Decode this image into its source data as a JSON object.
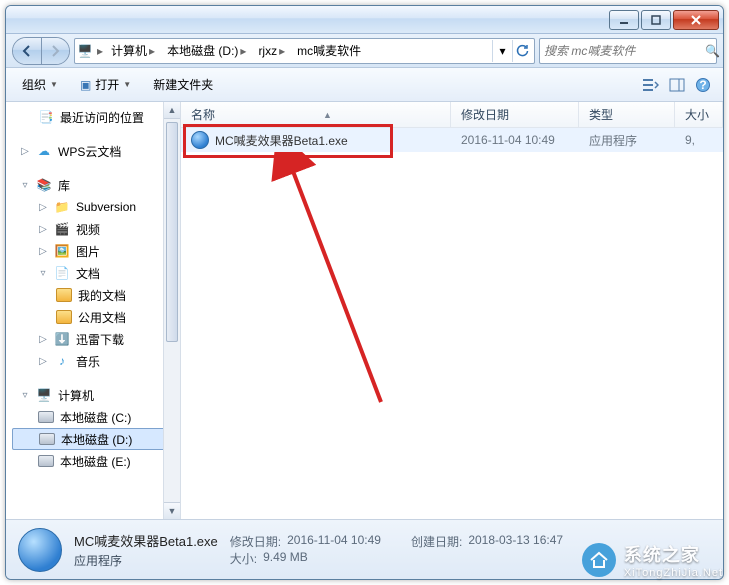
{
  "breadcrumbs": [
    "计算机",
    "本地磁盘 (D:)",
    "rjxz",
    "mc喊麦软件"
  ],
  "search": {
    "placeholder": "搜索 mc喊麦软件"
  },
  "toolbar": {
    "organize": "组织",
    "open": "打开",
    "newfolder": "新建文件夹"
  },
  "columns": {
    "name": "名称",
    "date": "修改日期",
    "type": "类型",
    "size": "大小"
  },
  "rows": [
    {
      "name": "MC喊麦效果器Beta1.exe",
      "date": "2016-11-04 10:49",
      "type": "应用程序",
      "size": "9,"
    }
  ],
  "sidebar": {
    "recent": "最近访问的位置",
    "wps": "WPS云文档",
    "lib": "库",
    "subversion": "Subversion",
    "video": "视频",
    "picture": "图片",
    "doc": "文档",
    "mydoc": "我的文档",
    "pubdoc": "公用文档",
    "xunlei": "迅雷下载",
    "music": "音乐",
    "computer": "计算机",
    "diskC": "本地磁盘 (C:)",
    "diskD": "本地磁盘 (D:)",
    "diskE": "本地磁盘 (E:)"
  },
  "details": {
    "filename": "MC喊麦效果器Beta1.exe",
    "apptype": "应用程序",
    "modlabel": "修改日期:",
    "modval": "2016-11-04 10:49",
    "sizelabel": "大小:",
    "sizeval": "9.49 MB",
    "createlabel": "创建日期:",
    "createval": "2018-03-13 16:47"
  },
  "watermark": {
    "text": "系统之家",
    "url": "XiTongZhiJia.Net"
  }
}
